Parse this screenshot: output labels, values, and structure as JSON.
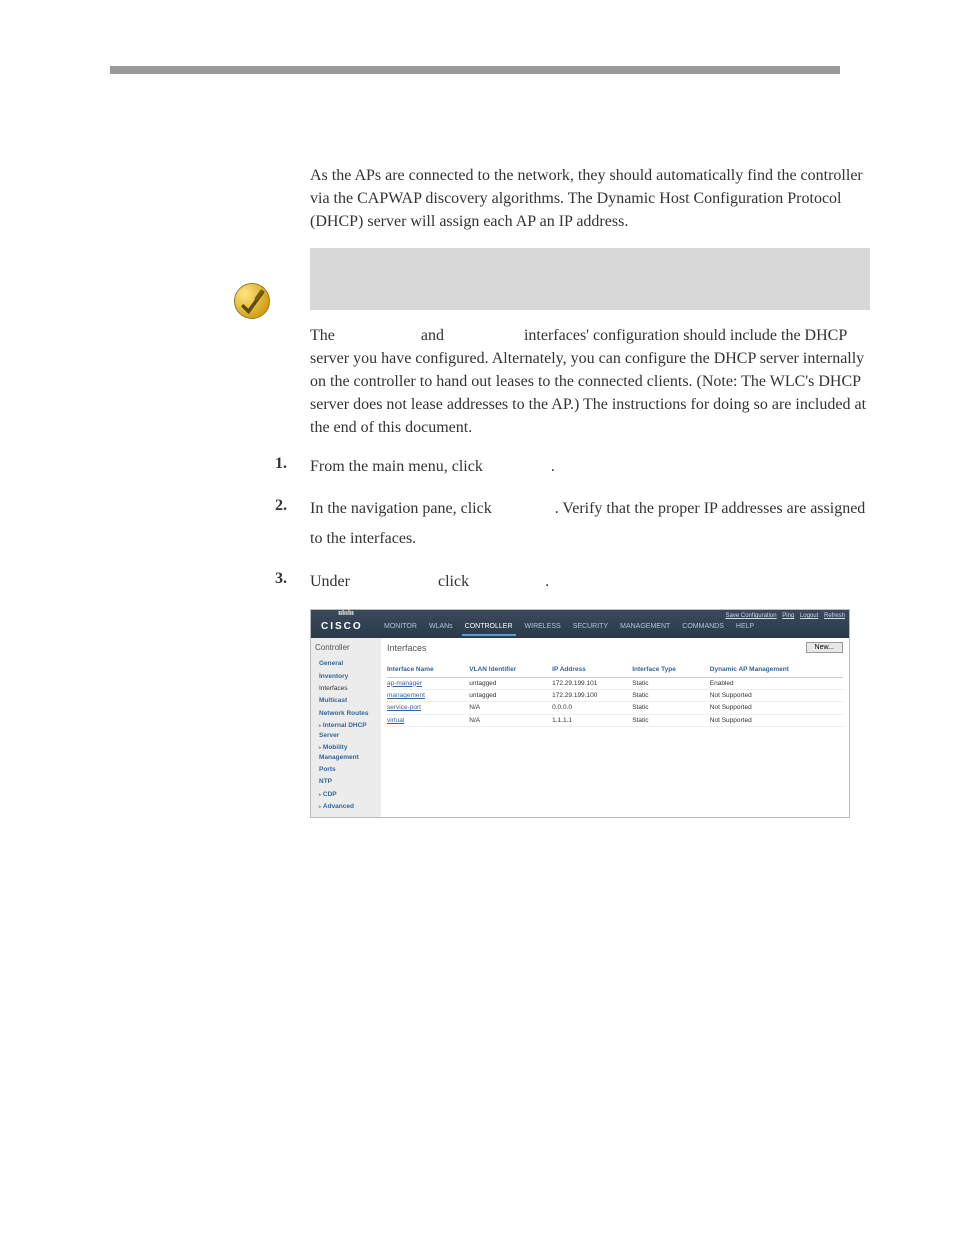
{
  "paragraphs": {
    "p1": "As the APs are connected to the network, they should automatically find the controller via the CAPWAP discovery algorithms. The Dynamic Host Configuration Protocol (DHCP) server will assign each AP an IP address.",
    "p2a": "The",
    "p2b": "and",
    "p2c": "interfaces' configuration should include the DHCP server you have configured. Alternately, you can configure the DHCP server internally on the controller to hand out leases to the connected clients. (Note: The WLC's DHCP server does not lease addresses to the AP.) The instructions for doing so are included at the end of this document."
  },
  "steps": [
    {
      "num": "1.",
      "a": "From the main menu, click ",
      "b": "."
    },
    {
      "num": "2.",
      "a": "In the navigation pane, click ",
      "b": ". Verify that the proper IP addresses are assigned to the interfaces."
    },
    {
      "num": "3.",
      "a": "Under ",
      "b": "click",
      "c": "."
    }
  ],
  "screenshot": {
    "logo": "CISCO",
    "logo_dots": "ıılıılıı",
    "toplinks": [
      "Save Configuration",
      "Ping",
      "Logout",
      "Refresh"
    ],
    "nav": [
      "MONITOR",
      "WLANs",
      "CONTROLLER",
      "WIRELESS",
      "SECURITY",
      "MANAGEMENT",
      "COMMANDS",
      "HELP"
    ],
    "nav_active": "CONTROLLER",
    "sidebar_title": "Controller",
    "sidebar": [
      {
        "label": "General"
      },
      {
        "label": "Inventory"
      },
      {
        "label": "Interfaces",
        "sel": true
      },
      {
        "label": "Multicast"
      },
      {
        "label": "Network Routes"
      },
      {
        "label": "Internal DHCP Server",
        "tree": true
      },
      {
        "label": "Mobility Management",
        "tree": true
      },
      {
        "label": "Ports"
      },
      {
        "label": "NTP"
      },
      {
        "label": "CDP",
        "tree": true
      },
      {
        "label": "Advanced",
        "tree": true
      }
    ],
    "main_title": "Interfaces",
    "new_button": "New...",
    "table_headers": [
      "Interface Name",
      "VLAN Identifier",
      "IP Address",
      "Interface Type",
      "Dynamic AP Management"
    ],
    "table_rows": [
      [
        "ap-manager",
        "untagged",
        "172.29.199.101",
        "Static",
        "Enabled"
      ],
      [
        "management",
        "untagged",
        "172.29.199.100",
        "Static",
        "Not Supported"
      ],
      [
        "service-port",
        "N/A",
        "0.0.0.0",
        "Static",
        "Not Supported"
      ],
      [
        "virtual",
        "N/A",
        "1.1.1.1",
        "Static",
        "Not Supported"
      ]
    ]
  }
}
